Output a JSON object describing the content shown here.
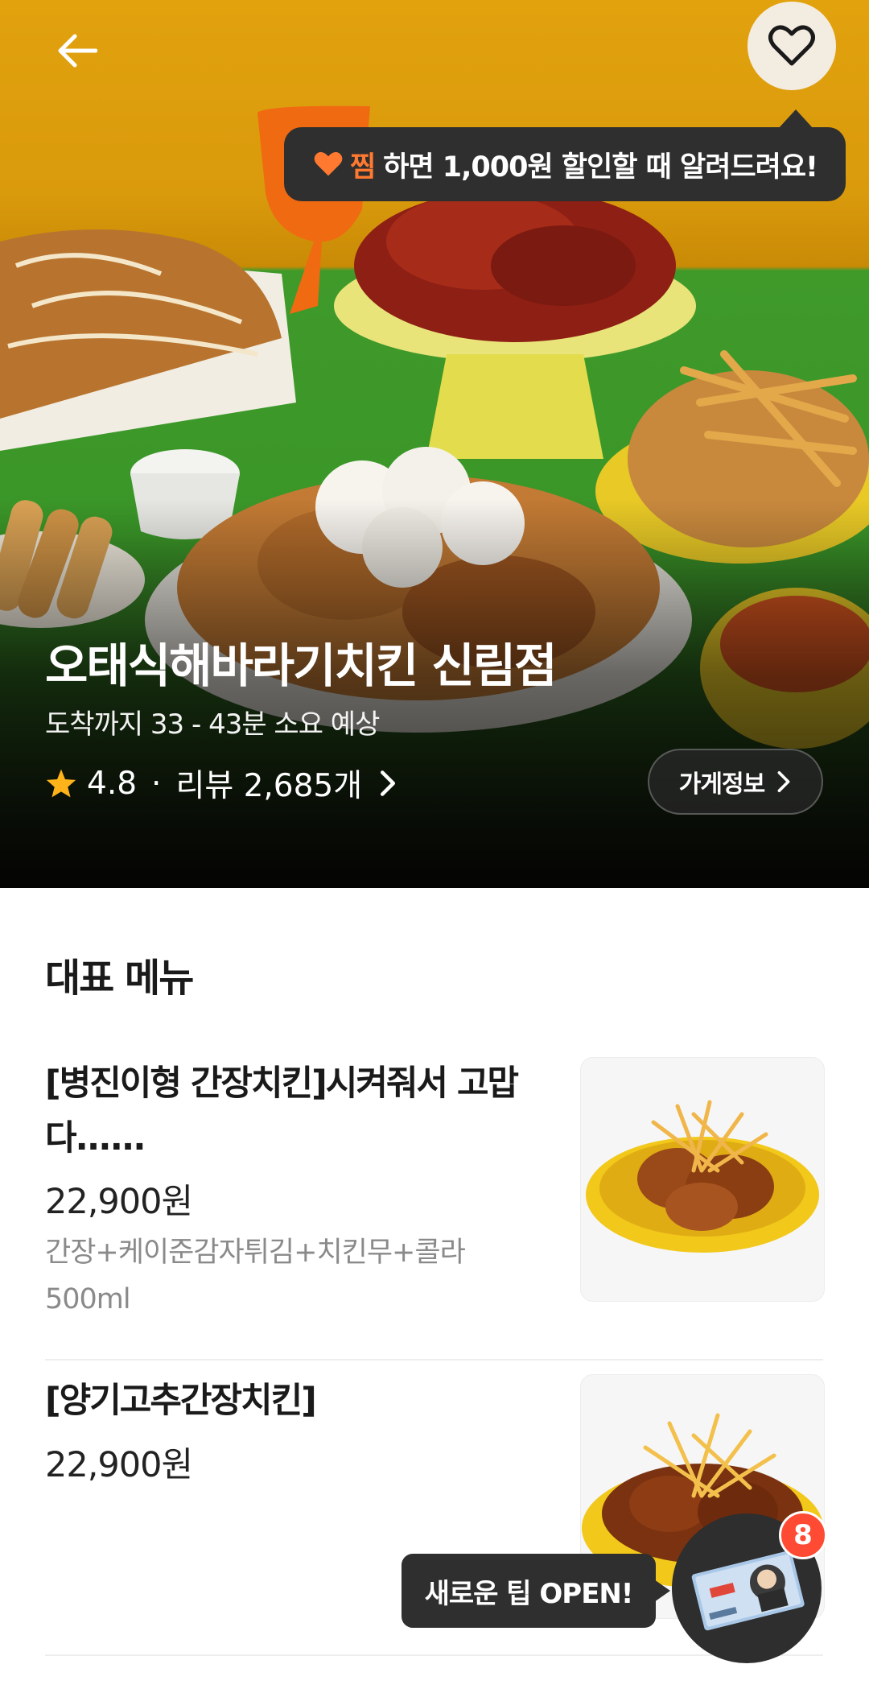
{
  "tooltip": {
    "zzim": "찜",
    "text": "하면 1,000원 할인할 때 알려드려요!"
  },
  "store": {
    "name": "오태식해바라기치킨 신림점",
    "eta": "도착까지 33 - 43분 소요 예상",
    "rating": "4.8",
    "dot": "·",
    "reviews": "리뷰 2,685개",
    "info_button": "가게정보"
  },
  "menu": {
    "section_title": "대표 메뉴",
    "items": [
      {
        "name": "[병진이형 간장치킨]시켜줘서 고맙다......",
        "price": "22,900원",
        "desc": "간장+케이준감자튀김+치킨무+콜라 500ml"
      },
      {
        "name": "[양기고추간장치킨]",
        "price": "22,900원"
      }
    ]
  },
  "floating": {
    "tip": "새로운 팁 OPEN!",
    "badge": "8"
  },
  "colors": {
    "accent": "#ff7a30",
    "star": "#ffb31a",
    "badge": "#ff4b33",
    "tooltip_bg": "#2f2f2f"
  }
}
